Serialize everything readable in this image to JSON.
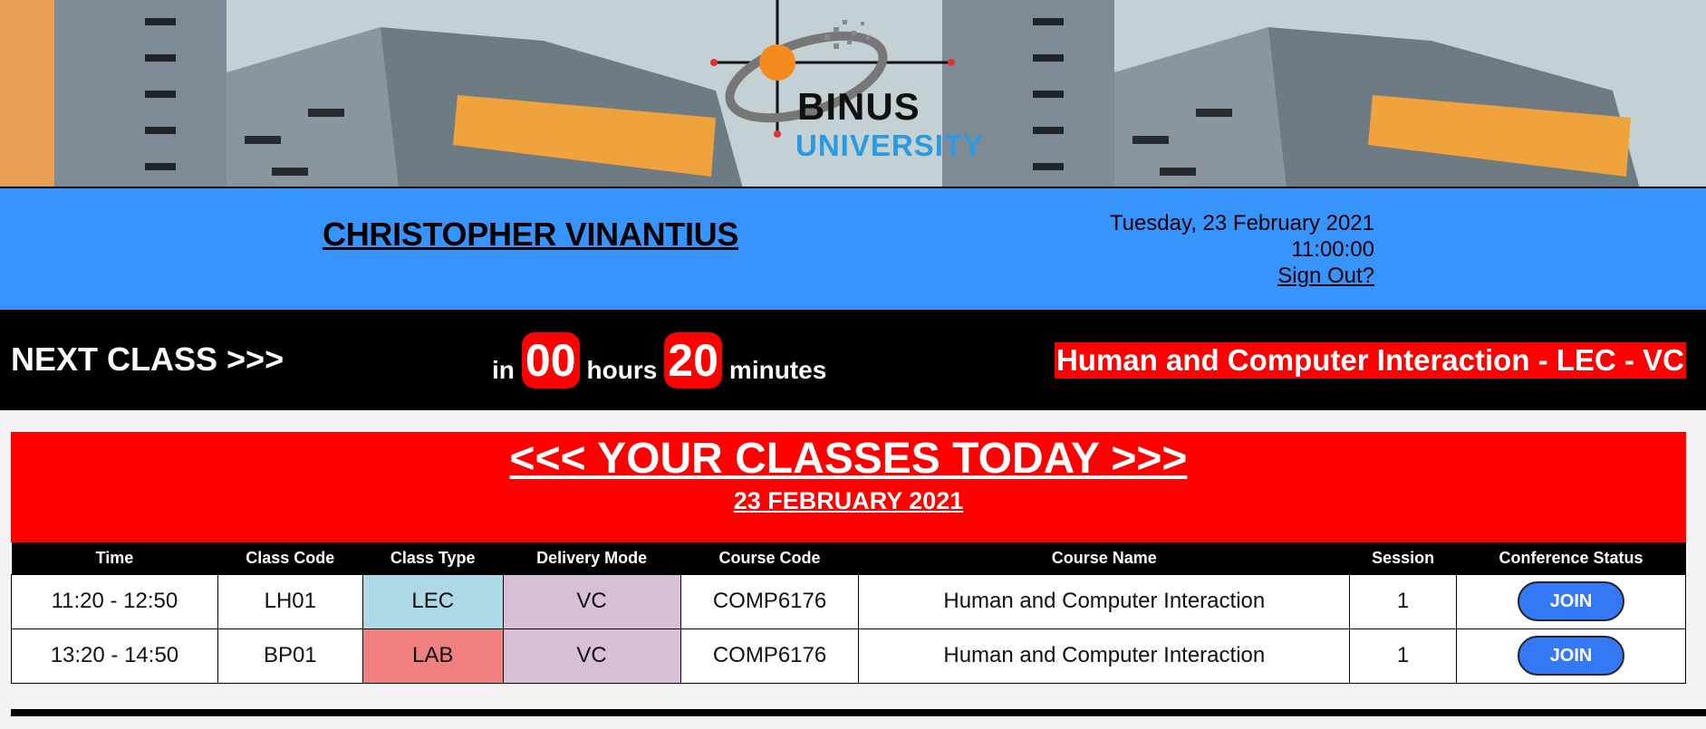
{
  "banner": {
    "logo_brand": "BINUS",
    "logo_sub": "UNIVERSITY",
    "building_sign": "BINUS UNIVERSITY"
  },
  "student": {
    "name": "CHRISTOPHER VINANTIUS"
  },
  "datetime": {
    "date": "Tuesday, 23 February 2021",
    "time": "11:00:00",
    "sign_out": "Sign Out?"
  },
  "next_class": {
    "label": "NEXT CLASS >>>",
    "prefix": "in",
    "hours": "00",
    "hours_word": "hours",
    "minutes": "20",
    "minutes_word": "minutes",
    "course": "Human and Computer Interaction - LEC - VC"
  },
  "classes": {
    "title": "<<< YOUR CLASSES TODAY >>>",
    "date": "23 FEBRUARY 2021",
    "columns": [
      "Time",
      "Class Code",
      "Class Type",
      "Delivery Mode",
      "Course Code",
      "Course Name",
      "Session",
      "Conference Status"
    ],
    "rows": [
      {
        "time": "11:20 - 12:50",
        "class_code": "LH01",
        "class_type": "LEC",
        "delivery_mode": "VC",
        "course_code": "COMP6176",
        "course_name": "Human and Computer Interaction",
        "session": "1",
        "status_button": "JOIN"
      },
      {
        "time": "13:20 - 14:50",
        "class_code": "BP01",
        "class_type": "LAB",
        "delivery_mode": "VC",
        "course_code": "COMP6176",
        "course_name": "Human and Computer Interaction",
        "session": "1",
        "status_button": "JOIN"
      }
    ]
  },
  "colors": {
    "info_bar": "#3894fd",
    "accent_red": "#ff0000",
    "lec": "#add8e6",
    "lab": "#f08080",
    "vc": "#d8bfd8",
    "join": "#3478f6"
  }
}
